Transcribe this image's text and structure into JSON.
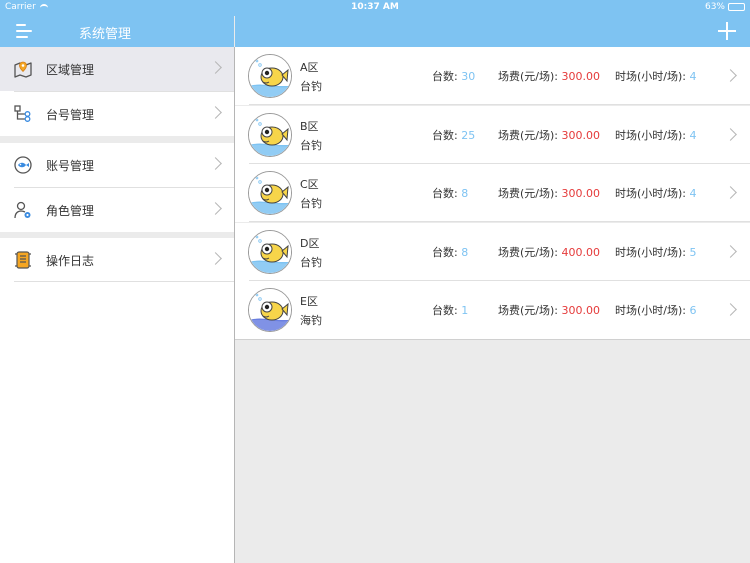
{
  "status": {
    "carrier": "Carrier",
    "time": "10:37 AM",
    "battery": "63%",
    "battery_level": 0.63
  },
  "sidebar": {
    "title": "系统管理",
    "items": [
      {
        "label": "区域管理",
        "icon": "map-pin-icon",
        "active": true
      },
      {
        "label": "台号管理",
        "icon": "tree-icon",
        "active": false
      },
      {
        "label": "账号管理",
        "icon": "fish-icon",
        "active": false
      },
      {
        "label": "角色管理",
        "icon": "user-gear-icon",
        "active": false
      },
      {
        "label": "操作日志",
        "icon": "scroll-icon",
        "active": false
      }
    ]
  },
  "header": {
    "add_icon": "plus-icon"
  },
  "colors": {
    "accent": "#7ec3f2",
    "price": "#e53b3b",
    "value": "#7ec3f2"
  },
  "labels": {
    "count": "台数: ",
    "fee": "场费(元/场): ",
    "duration": "时场(小时/场): "
  },
  "areas": [
    {
      "name": "A区",
      "type": "台钓",
      "count": "30",
      "fee": "300.00",
      "duration": "4",
      "water": "#7ec3f2"
    },
    {
      "name": "B区",
      "type": "台钓",
      "count": "25",
      "fee": "300.00",
      "duration": "4",
      "water": "#7ec3f2"
    },
    {
      "name": "C区",
      "type": "台钓",
      "count": "8",
      "fee": "300.00",
      "duration": "4",
      "water": "#7ec3f2"
    },
    {
      "name": "D区",
      "type": "台钓",
      "count": "8",
      "fee": "400.00",
      "duration": "5",
      "water": "#7ec3f2"
    },
    {
      "name": "E区",
      "type": "海钓",
      "count": "1",
      "fee": "300.00",
      "duration": "6",
      "water": "#6a7fe0"
    }
  ]
}
